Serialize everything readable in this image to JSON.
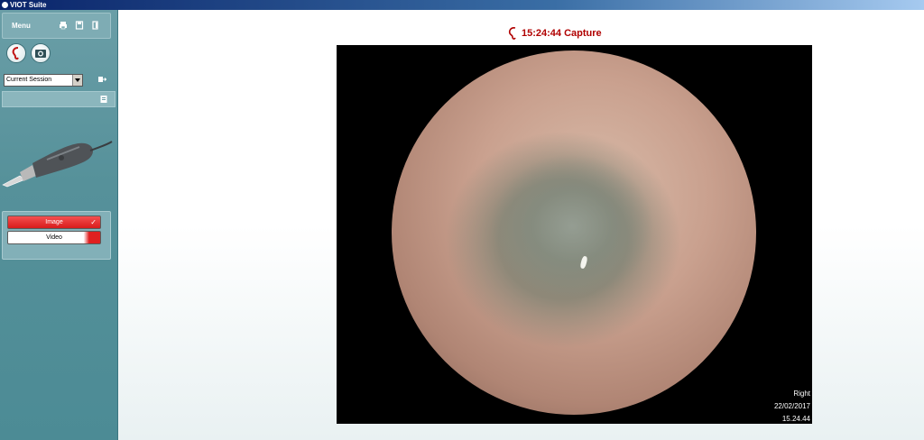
{
  "window": {
    "title": "VIOT Suite"
  },
  "sidebar": {
    "menu_label": "Menu",
    "session_select": {
      "value": "Current Session"
    },
    "modes": [
      {
        "label": "Image",
        "selected": true
      },
      {
        "label": "Video",
        "selected": false
      }
    ]
  },
  "capture": {
    "title": "15:24:44 Capture",
    "overlay": {
      "side": "Right",
      "date": "22/02/2017",
      "time": "15.24.44"
    }
  },
  "colors": {
    "accent_red": "#b00000",
    "sidebar_teal": "#56919a",
    "titlebar_blue": "#0a246a"
  },
  "icons": [
    "print-icon",
    "save-icon",
    "exit-icon",
    "ear-icon",
    "camera-icon",
    "session-export-icon",
    "notes-icon",
    "otoscope-probe-image"
  ]
}
